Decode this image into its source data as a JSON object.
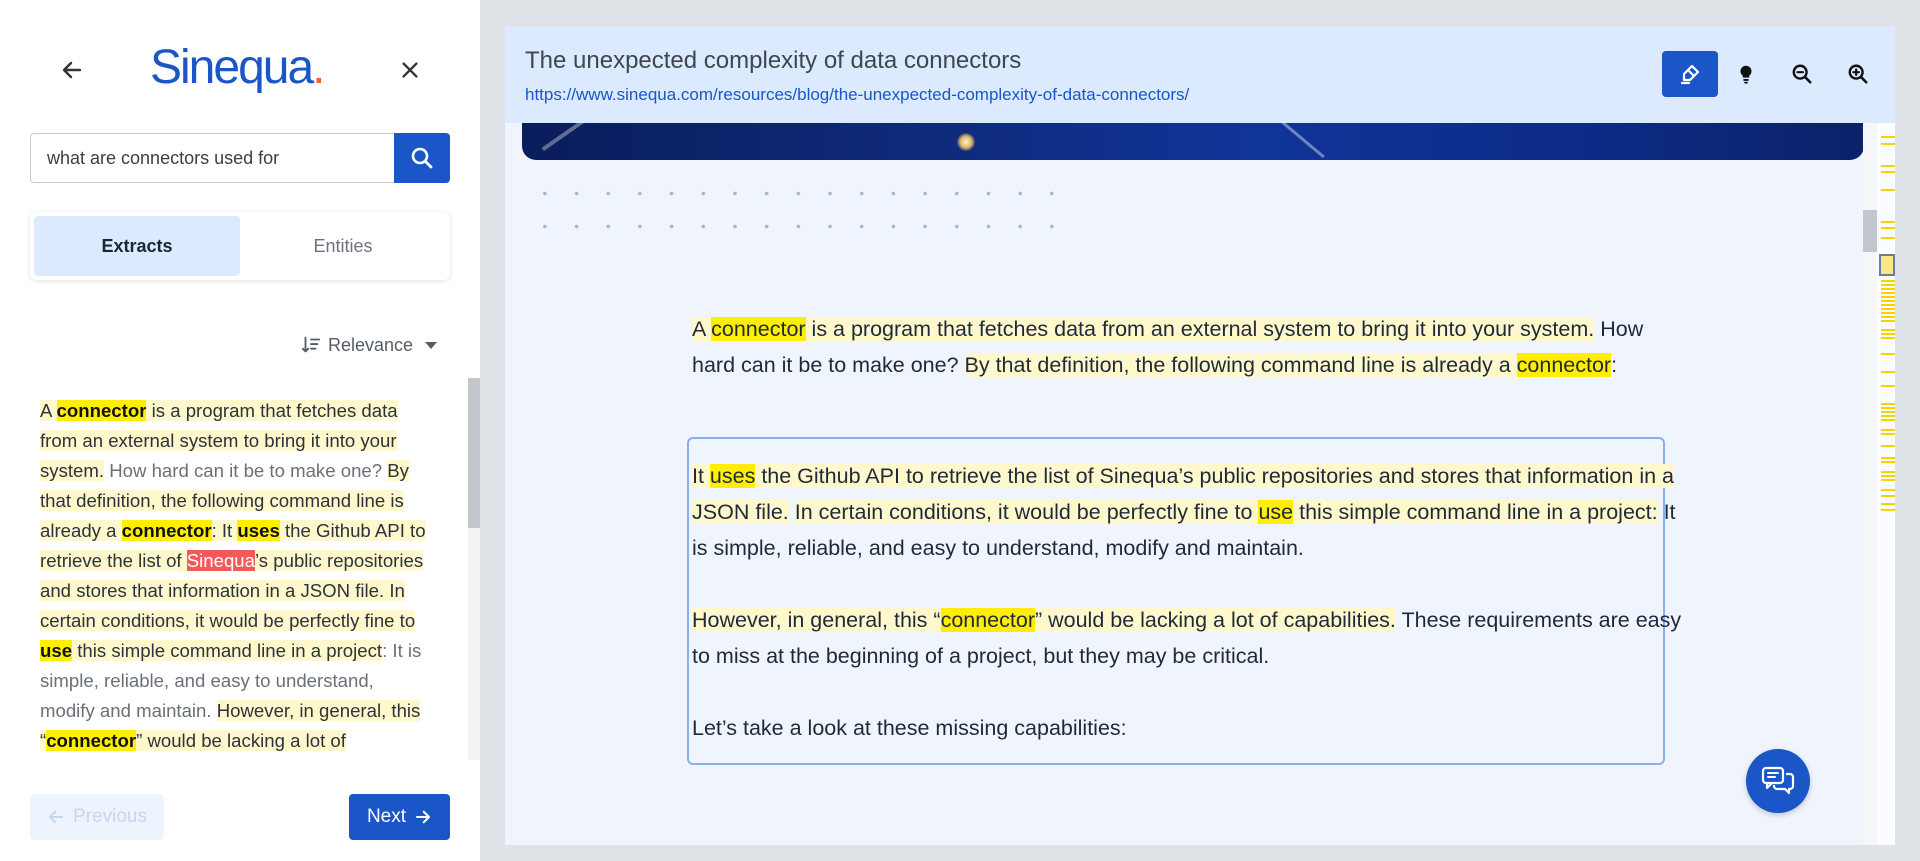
{
  "left_panel": {
    "logo_text": "Sinequa",
    "logo_dot_text": ".",
    "back_icon": "arrow-left-icon",
    "close_icon": "close-icon",
    "search": {
      "value": "what are connectors used for",
      "button_icon": "search-icon"
    },
    "tabs": [
      {
        "label": "Extracts",
        "active": true
      },
      {
        "label": "Entities",
        "active": false
      }
    ],
    "sort_label": "Relevance",
    "extract_segments": [
      {
        "t": "A ",
        "s": "hl"
      },
      {
        "t": "connector",
        "s": "kw"
      },
      {
        "t": " is a program that fetches data from an external system to bring it into your system.",
        "s": "hl"
      },
      {
        "t": " How hard can it be to make one? ",
        "s": "dim"
      },
      {
        "t": "By that definition, the following command line is already a ",
        "s": "hl"
      },
      {
        "t": "connector",
        "s": "kw"
      },
      {
        "t": ": It ",
        "s": "hl"
      },
      {
        "t": "uses",
        "s": "kw"
      },
      {
        "t": " the Github API to retrieve the list of ",
        "s": "hl"
      },
      {
        "t": "Sinequa",
        "s": "ent"
      },
      {
        "t": "’s public repositories and stores that information in a JSON file.",
        "s": "hl"
      },
      {
        "t": " In certain conditions, it would be perfectly fine to ",
        "s": "hl"
      },
      {
        "t": "use",
        "s": "kw"
      },
      {
        "t": " this simple command line in a project",
        "s": "hl"
      },
      {
        "t": ": It is simple, reliable, and easy to understand, modify and maintain. ",
        "s": "dim"
      },
      {
        "t": "However, in general, this “",
        "s": "hl"
      },
      {
        "t": "connector",
        "s": "kw"
      },
      {
        "t": "” would be lacking a lot of capabilities.",
        "s": "hl"
      }
    ],
    "previous_label": "Previous",
    "next_label": "Next"
  },
  "viewer": {
    "title": "The unexpected complexity of data connectors",
    "url": "https://www.sinequa.com/resources/blog/the-unexpected-complexity-of-data-connectors/",
    "tools": [
      {
        "icon": "highlighter-icon",
        "active": true
      },
      {
        "icon": "lightbulb-icon",
        "active": false
      },
      {
        "icon": "zoom-out-icon",
        "active": false
      },
      {
        "icon": "zoom-in-icon",
        "active": false
      }
    ],
    "paragraph1": [
      {
        "t": "A ",
        "s": "hl"
      },
      {
        "t": "connector",
        "s": "kw"
      },
      {
        "t": " is a program that fetches data from an external system to bring it into your system.",
        "s": "hl"
      },
      {
        "t": " How hard can it be to make one? ",
        "s": ""
      },
      {
        "t": "By that definition, the following command line is already a ",
        "s": "hl"
      },
      {
        "t": "connector",
        "s": "kw"
      },
      {
        "t": ":",
        "s": ""
      }
    ],
    "paragraph2": [
      {
        "t": "It ",
        "s": "hl"
      },
      {
        "t": "uses",
        "s": "kw"
      },
      {
        "t": " the Github API to retrieve the list of Sinequa’s public repositories and stores that information in a JSON file.",
        "s": "hl"
      },
      {
        "t": " ",
        "s": ""
      },
      {
        "t": "In certain conditions, it would be perfectly fine to ",
        "s": "hl"
      },
      {
        "t": "use",
        "s": "kw"
      },
      {
        "t": " this simple command line in a project:",
        "s": "hl"
      },
      {
        "t": " It is simple, reliable, and easy to understand, modify and maintain.",
        "s": ""
      }
    ],
    "paragraph3": [
      {
        "t": "However, in general, this “",
        "s": "hl"
      },
      {
        "t": "connector",
        "s": "kw"
      },
      {
        "t": "” would be lacking a lot of capabilities.",
        "s": "hl"
      },
      {
        "t": " These requirements are easy to miss at the beginning of a project, but they may be critical.",
        "s": ""
      }
    ],
    "paragraph4": [
      {
        "t": "Let’s take a look at these missing capabilities:",
        "s": ""
      }
    ],
    "chat_icon": "chat-icon",
    "colors": {
      "accent": "#1a56c8",
      "highlight": "#fff8cc",
      "keyword": "#ffee00",
      "entity": "#f05a5a"
    }
  }
}
